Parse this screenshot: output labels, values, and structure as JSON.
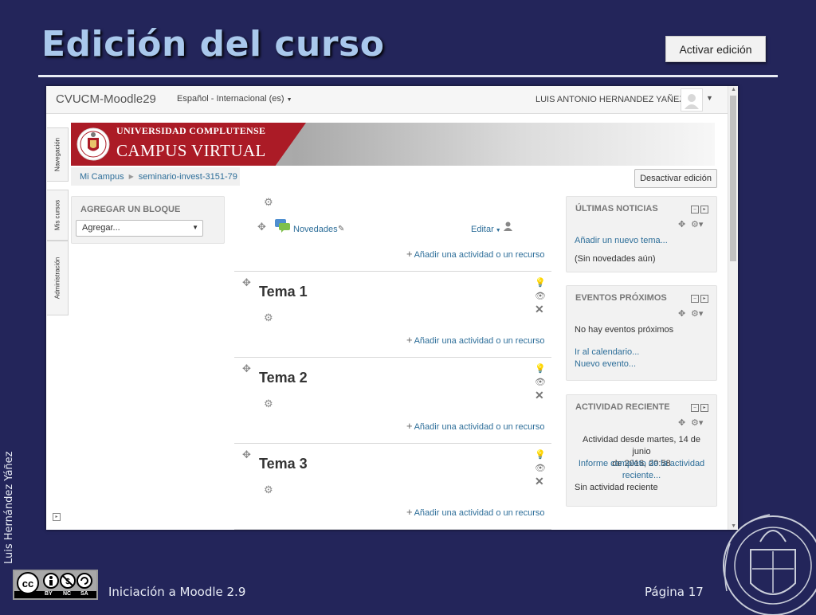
{
  "slide": {
    "title": "Edición del curso",
    "activar_button": "Activar edición",
    "author": "Luis Hernández Yáñez",
    "footer_left": "Iniciación a Moodle 2.9",
    "footer_right": "Página 17",
    "cc_labels": [
      "BY",
      "NC",
      "SA"
    ]
  },
  "navbar": {
    "brand": "CVUCM-Moodle29",
    "language": "Español - Internacional (es)",
    "user": "LUIS ANTONIO HERNANDEZ YAÑEZ"
  },
  "side_tabs": [
    "Navegación",
    "Mis cursos",
    "Administración"
  ],
  "banner": {
    "line1": "UNIVERSIDAD COMPLUTENSE",
    "line2": "CAMPUS VIRTUAL"
  },
  "breadcrumb": [
    "Mi Campus",
    "seminario-invest-3151-79"
  ],
  "desactivar_button": "Desactivar edición",
  "add_block": {
    "title": "AGREGAR UN BLOQUE",
    "select_value": "Agregar..."
  },
  "course": {
    "news_link": "Novedades",
    "edit_menu": "Editar",
    "add_activity": "Añadir una actividad o un recurso",
    "sections": [
      "Tema 1",
      "Tema 2",
      "Tema 3"
    ]
  },
  "blocks": {
    "news": {
      "title": "ÚLTIMAS NOTICIAS",
      "add_topic": "Añadir un nuevo tema...",
      "empty": "(Sin novedades aún)"
    },
    "events": {
      "title": "EVENTOS PRÓXIMOS",
      "empty": "No hay eventos próximos",
      "calendar_link": "Ir al calendario...",
      "new_event_link": "Nuevo evento..."
    },
    "recent": {
      "title": "ACTIVIDAD RECIENTE",
      "since_line1": "Actividad desde martes, 14 de junio",
      "since_line2": "de 2016, 20:58",
      "report_line1": "Informe completo de la actividad",
      "report_line2": "reciente...",
      "empty": "Sin actividad reciente"
    }
  },
  "colors": {
    "slide_background": "#23255a",
    "title": "#a9c8ec",
    "link": "#2d6e99",
    "banner_red": "#ab1b26"
  },
  "icons": {
    "section_highlight": "lightbulb-icon",
    "section_visibility": "eye-icon",
    "section_delete": "close-icon",
    "move": "move-icon",
    "settings": "gear-icon"
  }
}
